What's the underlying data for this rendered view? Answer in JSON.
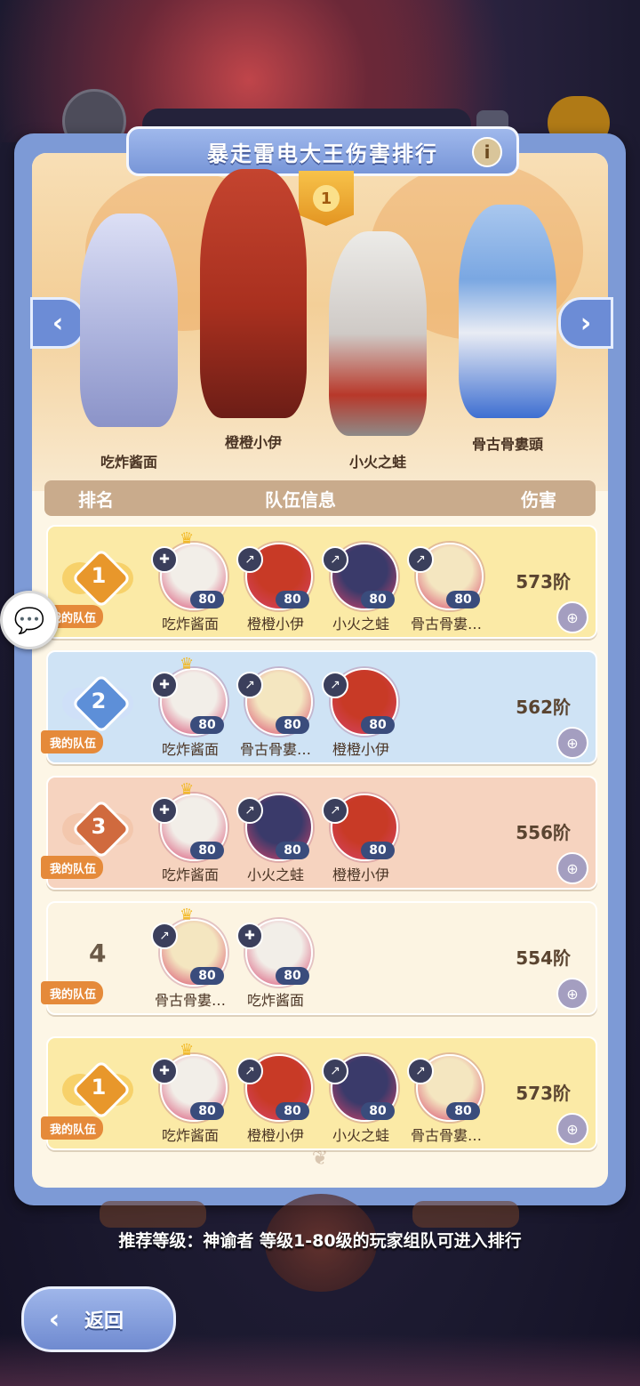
{
  "title": "暴走雷电大王伤害排行",
  "info_icon": "i",
  "top_rank": "1",
  "heroes": [
    {
      "name": "吃炸酱面",
      "color": "#c9cbe8"
    },
    {
      "name": "橙橙小伊",
      "color": "#c23b2c"
    },
    {
      "name": "小火之蛙",
      "color": "#e0dcd8"
    },
    {
      "name": "骨古骨婁頭",
      "color": "#8fb4e6"
    }
  ],
  "table_header": {
    "rank": "排名",
    "team": "队伍信息",
    "damage": "伤害"
  },
  "my_team_label": "我的队伍",
  "rows": [
    {
      "rank": "1",
      "style": "gold",
      "damage": "573阶",
      "members": [
        {
          "name": "吃炸酱面",
          "level": "80",
          "crown": true,
          "cls": "✚",
          "color": "#f2eee8"
        },
        {
          "name": "橙橙小伊",
          "level": "80",
          "crown": false,
          "cls": "↗",
          "color": "#c83a26"
        },
        {
          "name": "小火之蛙",
          "level": "80",
          "crown": false,
          "cls": "↗",
          "color": "#3a3a6a"
        },
        {
          "name": "骨古骨婁…",
          "level": "80",
          "crown": false,
          "cls": "↗",
          "color": "#f4e6c0"
        }
      ]
    },
    {
      "rank": "2",
      "style": "blue",
      "damage": "562阶",
      "members": [
        {
          "name": "吃炸酱面",
          "level": "80",
          "crown": true,
          "cls": "✚",
          "color": "#f2eee8"
        },
        {
          "name": "骨古骨婁…",
          "level": "80",
          "crown": false,
          "cls": "↗",
          "color": "#f4e6c0"
        },
        {
          "name": "橙橙小伊",
          "level": "80",
          "crown": false,
          "cls": "↗",
          "color": "#c83a26"
        }
      ]
    },
    {
      "rank": "3",
      "style": "bronze",
      "damage": "556阶",
      "members": [
        {
          "name": "吃炸酱面",
          "level": "80",
          "crown": true,
          "cls": "✚",
          "color": "#f2eee8"
        },
        {
          "name": "小火之蛙",
          "level": "80",
          "crown": false,
          "cls": "↗",
          "color": "#3a3a6a"
        },
        {
          "name": "橙橙小伊",
          "level": "80",
          "crown": false,
          "cls": "↗",
          "color": "#c83a26"
        }
      ]
    },
    {
      "rank": "4",
      "style": "plain",
      "damage": "554阶",
      "members": [
        {
          "name": "骨古骨婁…",
          "level": "80",
          "crown": true,
          "cls": "↗",
          "color": "#f4e6c0"
        },
        {
          "name": "吃炸酱面",
          "level": "80",
          "crown": false,
          "cls": "✚",
          "color": "#f2eee8"
        }
      ]
    },
    {
      "rank": "1",
      "style": "gold",
      "damage": "573阶",
      "members": [
        {
          "name": "吃炸酱面",
          "level": "80",
          "crown": true,
          "cls": "✚",
          "color": "#f2eee8"
        },
        {
          "name": "橙橙小伊",
          "level": "80",
          "crown": false,
          "cls": "↗",
          "color": "#c83a26"
        },
        {
          "name": "小火之蛙",
          "level": "80",
          "crown": false,
          "cls": "↗",
          "color": "#3a3a6a"
        },
        {
          "name": "骨古骨婁…",
          "level": "80",
          "crown": false,
          "cls": "↗",
          "color": "#f4e6c0"
        }
      ]
    }
  ],
  "recommend_text": "推荐等级：神谕者  等级1-80级的玩家组队可进入排行",
  "back_label": "返回",
  "colors": {
    "accent": "#7d9ad6",
    "gold": "#fbeaa6",
    "blue": "#cfe3f5",
    "bronze": "#f6d3bf",
    "plain": "#fcf4e2",
    "my_team": "#e58a3a"
  }
}
